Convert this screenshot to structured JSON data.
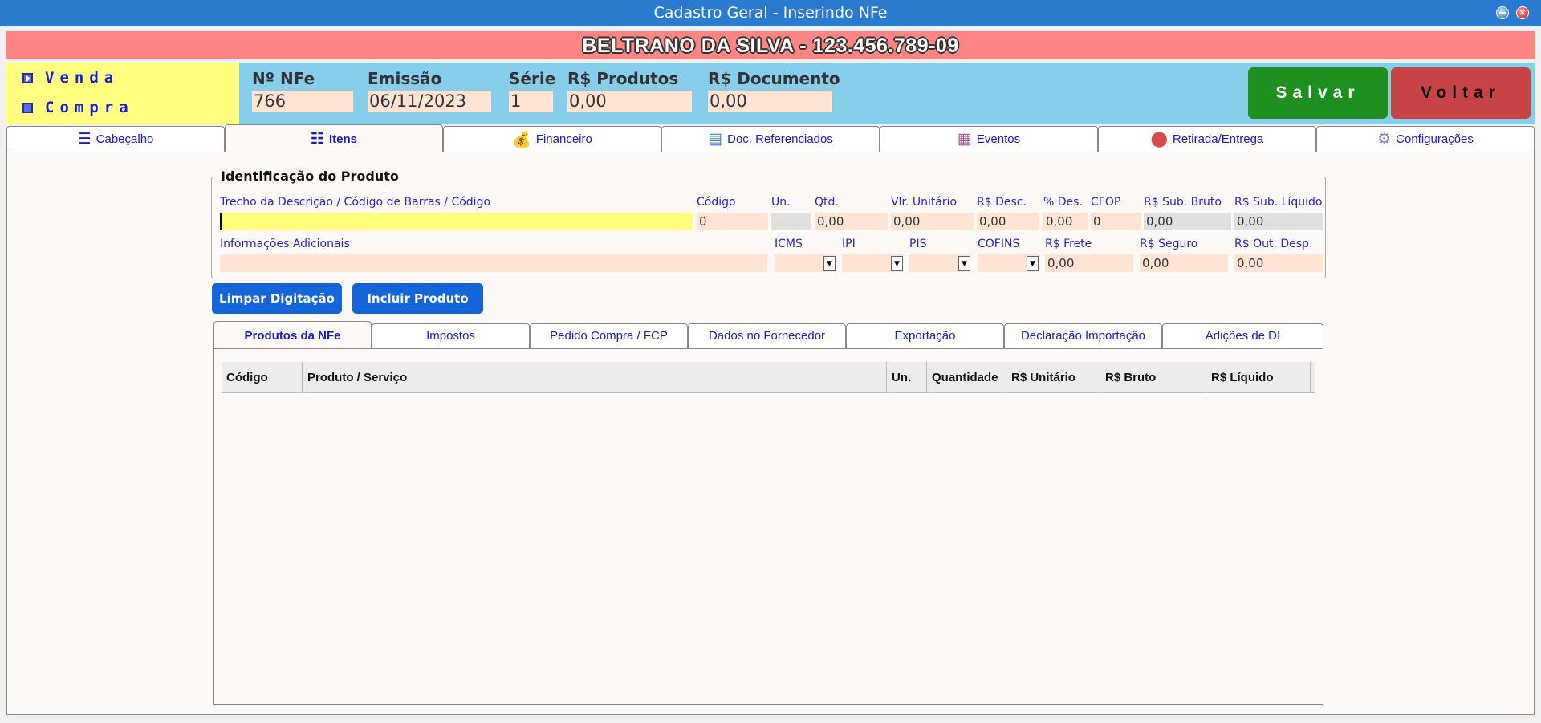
{
  "window": {
    "title": "Cadastro Geral - Inserindo NFe"
  },
  "banner": {
    "text": "BELTRANO DA SILVA - 123.456.789-09"
  },
  "operation": {
    "options": [
      {
        "label": "Venda",
        "selected": true
      },
      {
        "label": "Compra",
        "selected": false
      }
    ]
  },
  "header": {
    "numero_label": "Nº NFe",
    "numero_value": "766",
    "emissao_label": "Emissão",
    "emissao_value": "06/11/2023",
    "serie_label": "Série",
    "serie_value": "1",
    "produtos_label": "R$ Produtos",
    "produtos_value": "0,00",
    "documento_label": "R$ Documento",
    "documento_value": "0,00"
  },
  "actions": {
    "salvar": "Salvar",
    "voltar": "Voltar"
  },
  "main_tabs": [
    {
      "label": "Cabeçalho",
      "icon": "list-header-icon"
    },
    {
      "label": "Itens",
      "icon": "checklist-icon",
      "active": true
    },
    {
      "label": "Financeiro",
      "icon": "money-bag-icon"
    },
    {
      "label": "Doc. Referenciados",
      "icon": "document-icon"
    },
    {
      "label": "Eventos",
      "icon": "calendar-icon"
    },
    {
      "label": "Retirada/Entrega",
      "icon": "location-pin-icon"
    },
    {
      "label": "Configurações",
      "icon": "gears-icon"
    }
  ],
  "produto": {
    "group_title": "Identificação do Produto",
    "busca_label": "Trecho da Descrição / Código de Barras / Código",
    "busca_value": "",
    "codigo_label": "Código",
    "codigo_value": "0",
    "un_label": "Un.",
    "un_value": "",
    "qtd_label": "Qtd.",
    "qtd_value": "0,00",
    "vlr_unit_label": "Vlr. Unitário",
    "vlr_unit_value": "0,00",
    "desc_label": "R$ Desc.",
    "desc_value": "0,00",
    "pct_des_label": "% Des.",
    "pct_des_value": "0,00",
    "cfop_label": "CFOP",
    "cfop_value": "0",
    "sub_bruto_label": "R$ Sub. Bruto",
    "sub_bruto_value": "0,00",
    "sub_liquido_label": "R$ Sub. Líquido",
    "sub_liquido_value": "0,00",
    "info_label": "Informações Adicionais",
    "info_value": "",
    "icms_label": "ICMS",
    "ipi_label": "IPI",
    "pis_label": "PIS",
    "cofins_label": "COFINS",
    "frete_label": "R$ Frete",
    "frete_value": "0,00",
    "seguro_label": "R$ Seguro",
    "seguro_value": "0,00",
    "out_desp_label": "R$ Out. Desp.",
    "out_desp_value": "0,00"
  },
  "buttons": {
    "limpar": "Limpar Digitação",
    "incluir": "Incluir Produto"
  },
  "sub_tabs": [
    {
      "label": "Produtos da NFe",
      "active": true
    },
    {
      "label": "Impostos"
    },
    {
      "label": "Pedido Compra / FCP"
    },
    {
      "label": "Dados no Fornecedor"
    },
    {
      "label": "Exportação"
    },
    {
      "label": "Declaração Importação"
    },
    {
      "label": "Adições de DI"
    }
  ],
  "grid": {
    "columns": [
      "Código",
      "Produto / Serviço",
      "Un.",
      "Quantidade",
      "R$ Unitário",
      "R$ Bruto",
      "R$ Líquido"
    ],
    "rows": []
  }
}
